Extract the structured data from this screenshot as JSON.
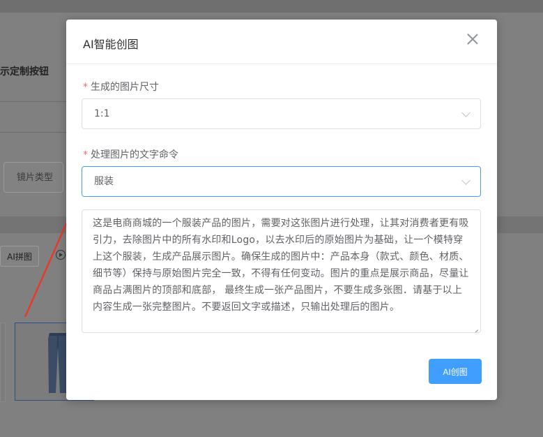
{
  "background": {
    "row_label": "示定制按钮",
    "lens_type_label": "镜片类型",
    "ai_pin_label": "AI拼图"
  },
  "modal": {
    "title": "AI智能创图",
    "size_field": {
      "label": "生成的图片尺寸",
      "required_mark": "*",
      "value": "1:1"
    },
    "command_field": {
      "label": "处理图片的文字命令",
      "required_mark": "*",
      "value": "服装"
    },
    "prompt_text": "这是电商商城的一个服装产品的图片，需要对这张图片进行处理，让其对消费者更有吸引力，去除图片中的所有水印和Logo，以去水印后的原始图片为基础，让一个模特穿上这个服装，生成产品展示图片。确保生成的图片中：产品本身（款式、颜色、材质、细节等）保持与原始图片完全一致，不得有任何变动。图片的重点是展示商品，尽量让商品占满图片的顶部和底部， 最终生成一张产品图片，不要生成多张图．请基于以上内容生成一张完整图片。不要返回文字或描述，只输出处理后的图片。",
    "submit_label": "AI创图"
  },
  "colors": {
    "primary": "#409eff",
    "required": "#f56c6c",
    "annotation_arrow": "#e8392b"
  }
}
